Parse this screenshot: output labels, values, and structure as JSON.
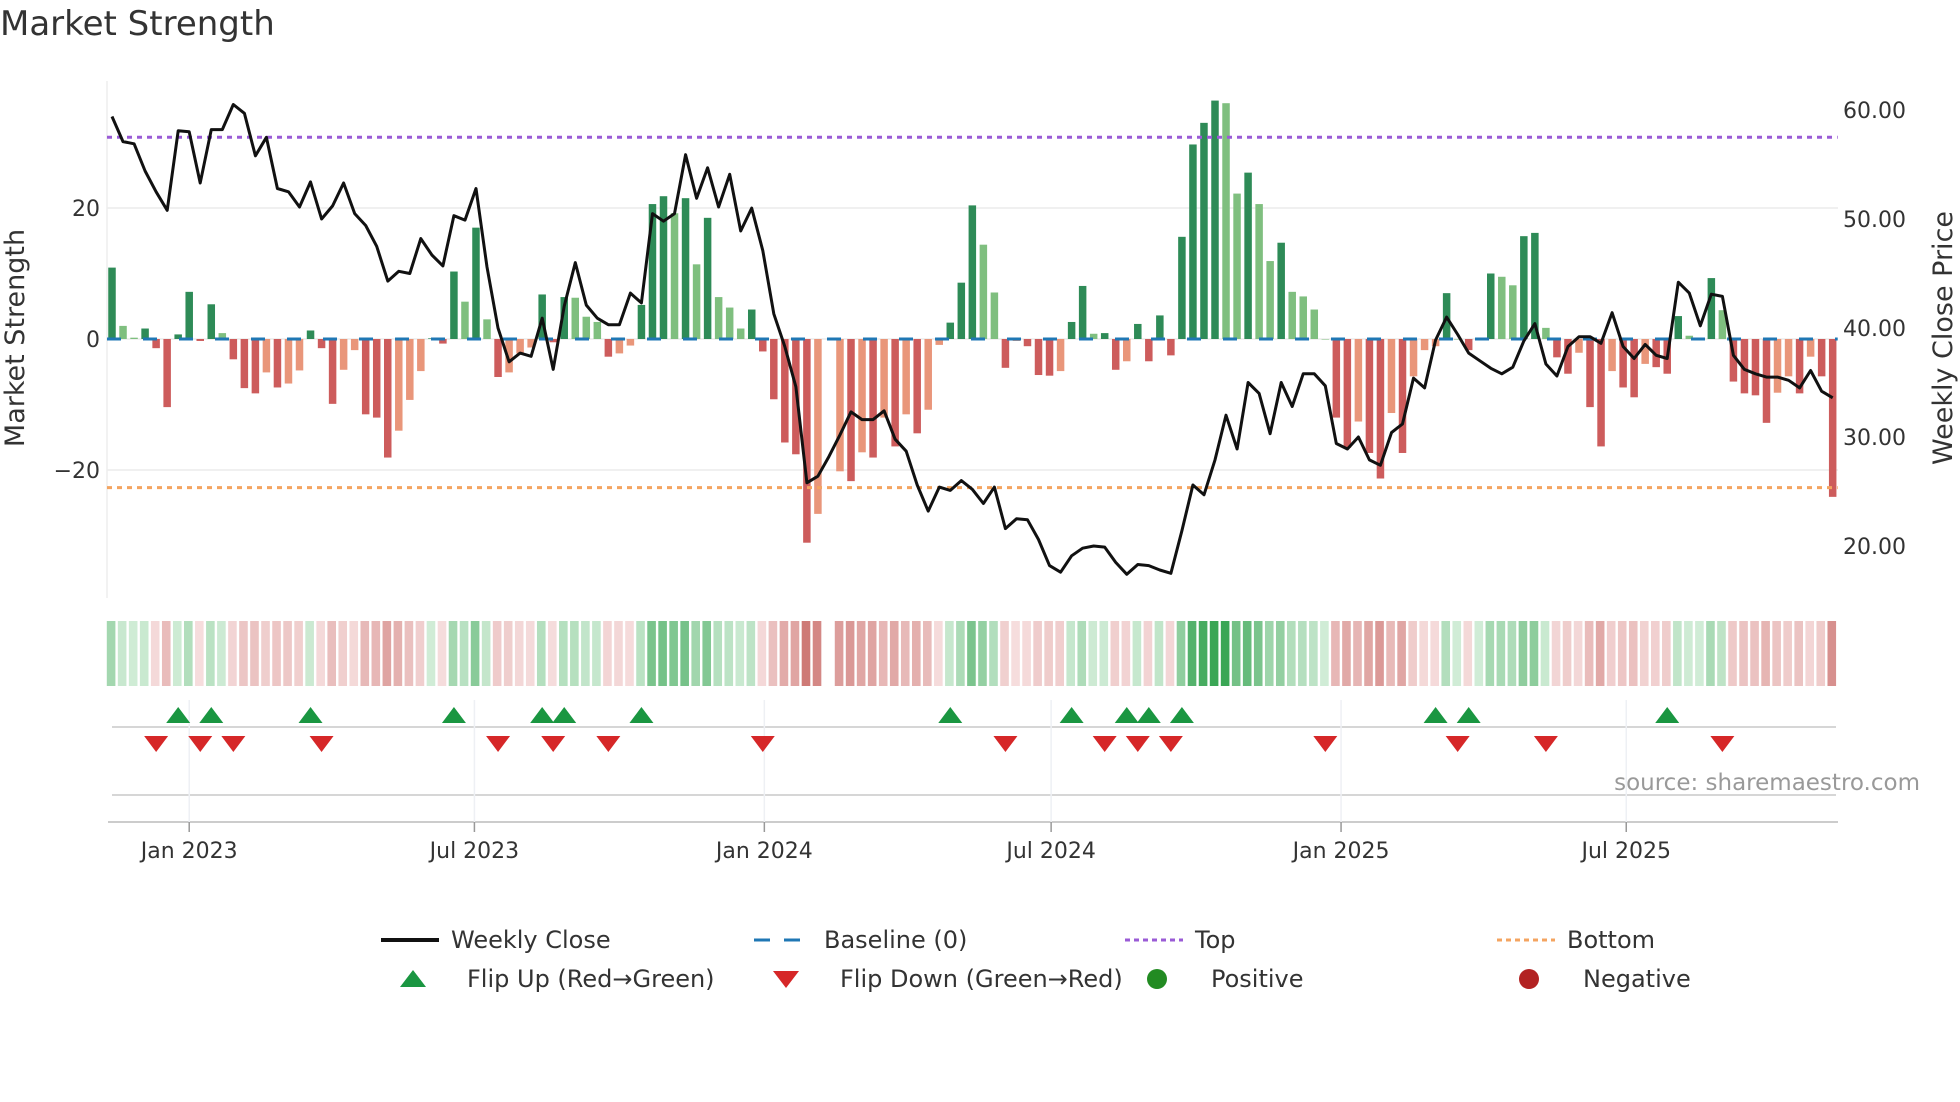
{
  "chart_data": {
    "type": "bar",
    "title": "Market Strength",
    "ylabel": "Market Strength",
    "y2label": "Weekly Close Price",
    "ylim": [
      -38,
      40
    ],
    "y2lim": [
      15.5,
      62
    ],
    "yticks": [
      -20,
      0,
      20
    ],
    "ytick_labels": [
      "−20",
      "0",
      "20"
    ],
    "y2ticks": [
      20,
      30,
      40,
      50,
      60
    ],
    "y2tick_labels": [
      "20.00",
      "30.00",
      "40.00",
      "50.00",
      "60.00"
    ],
    "first_week": "2022-11-13",
    "xtick_dates": [
      "2023-01-01",
      "2023-07-01",
      "2024-01-01",
      "2024-07-01",
      "2025-01-01",
      "2025-07-01"
    ],
    "xtick_labels": [
      "Jan 2023",
      "Jul 2023",
      "Jan 2024",
      "Jul 2024",
      "Jan 2025",
      "Jul 2025"
    ],
    "top_level": 30.8,
    "bottom_level": -22.7,
    "baseline": 0,
    "strength": [
      10.9,
      2,
      0.2,
      1.6,
      -1.4,
      -10.4,
      0.7,
      7.2,
      -0.3,
      5.3,
      0.9,
      -3.1,
      -7.5,
      -8.3,
      -5.1,
      -7.4,
      -6.8,
      -4.8,
      1.3,
      -1.4,
      -9.9,
      -4.7,
      -1.7,
      -11.5,
      -12,
      -18.1,
      -14,
      -9.3,
      -4.9,
      0.1,
      -0.7,
      10.3,
      5.7,
      17,
      3,
      -5.8,
      -5.1,
      -2.2,
      -1.3,
      6.8,
      -0.5,
      6.4,
      6.3,
      3.4,
      2.6,
      -2.7,
      -2.2,
      -1,
      5.2,
      20.6,
      21.8,
      19.2,
      21.5,
      11.4,
      18.5,
      6.4,
      4.8,
      1.6,
      4.5,
      -1.9,
      -9.2,
      -15.8,
      -17.6,
      -31.1,
      -26.7,
      null,
      -20.2,
      -21.7,
      -17.3,
      -18.1,
      -12,
      -16.4,
      -11.5,
      -14.4,
      -10.8,
      -0.9,
      2.5,
      8.6,
      20.4,
      14.4,
      7.1,
      -4.4,
      -0.3,
      -1.1,
      -5.5,
      -5.6,
      -4.9,
      2.6,
      8.1,
      0.8,
      0.9,
      -4.7,
      -3.4,
      2.3,
      -3.4,
      3.6,
      -2.5,
      15.6,
      29.7,
      33,
      36.4,
      36,
      22.2,
      25.4,
      20.6,
      11.9,
      14.7,
      7.2,
      6.5,
      4.5,
      0,
      -12,
      -16.6,
      -12.6,
      -17.4,
      -21.3,
      -11.3,
      -17.4,
      -5.7,
      -1.7,
      -1.1,
      7,
      0,
      -1.7,
      0,
      10,
      9.5,
      8.2,
      15.7,
      16.2,
      1.7,
      -2.8,
      -5.3,
      -2.1,
      -10.4,
      -16.4,
      -4.9,
      -7.4,
      -8.9,
      -3.8,
      -4.3,
      -5.3,
      3.5,
      0.5,
      0,
      9.3,
      4.4,
      -6.5,
      -8.3,
      -8.6,
      -12.8,
      -8.2,
      -5.7,
      -8.3,
      -2.7,
      -5.7,
      -24.1
    ],
    "weekly_close": [
      59.4,
      57.1,
      56.9,
      54.4,
      52.5,
      50.8,
      58.1,
      58,
      53.3,
      58.2,
      58.2,
      60.5,
      59.7,
      55.8,
      57.5,
      52.8,
      52.5,
      51.1,
      53.4,
      50,
      51.2,
      53.3,
      50.5,
      49.4,
      47.5,
      44.3,
      45.2,
      45,
      48.2,
      46.7,
      45.7,
      50.3,
      49.9,
      52.8,
      45.6,
      40,
      36.9,
      37.7,
      37.4,
      40.9,
      36.2,
      42,
      46,
      42.1,
      40.9,
      40.3,
      40.3,
      43.2,
      42.3,
      50.5,
      49.8,
      50.5,
      55.9,
      51.9,
      54.7,
      51.1,
      54.1,
      48.9,
      51,
      47.1,
      41.3,
      38.3,
      34.6,
      25.8,
      26.4,
      28.2,
      30.2,
      32.3,
      31.6,
      31.6,
      32.4,
      29.8,
      28.7,
      25.6,
      23.2,
      25.4,
      25.1,
      26,
      25.2,
      23.9,
      25.4,
      21.6,
      22.5,
      22.4,
      20.6,
      18.2,
      17.6,
      19.1,
      19.8,
      20,
      19.9,
      18.5,
      17.4,
      18.3,
      18.2,
      17.8,
      17.5,
      21.4,
      25.6,
      24.7,
      27.9,
      32,
      28.9,
      35,
      34,
      30.3,
      35,
      32.8,
      35.8,
      35.8,
      34.7,
      29.4,
      28.9,
      30,
      27.9,
      27.4,
      30.4,
      31.2,
      35.4,
      34.5,
      38.9,
      41,
      39.4,
      37.7,
      37,
      36.3,
      35.8,
      36.4,
      38.8,
      40.4,
      36.7,
      35.6,
      38.3,
      39.2,
      39.2,
      38.6,
      41.4,
      38.3,
      37.2,
      38.5,
      37.5,
      37.2,
      44.2,
      43.2,
      40.2,
      43.1,
      42.9,
      37.5,
      36.2,
      35.8,
      35.5,
      35.5,
      35.2,
      34.5,
      36.1,
      34.2,
      33.6
    ],
    "flip_up_weeks": [
      6,
      9,
      18,
      31,
      39,
      41,
      48,
      76,
      87,
      92,
      94,
      97,
      120,
      123,
      141
    ],
    "flip_down_weeks": [
      4,
      8,
      11,
      19,
      35,
      40,
      45,
      59,
      81,
      90,
      93,
      96,
      110,
      122,
      130,
      146
    ],
    "legend": {
      "close": "Weekly Close",
      "baseline": "Baseline (0)",
      "top": "Top",
      "bottom": "Bottom",
      "flip_up": "Flip Up (Red→Green)",
      "flip_down": "Flip Down (Green→Red)",
      "positive": "Positive",
      "negative": "Negative"
    },
    "legend_placement": "bottom",
    "source": "source: sharemaestro.com",
    "colors": {
      "pos_strong": "#2e8b57",
      "pos_weak": "#7fbf7f",
      "neg_strong": "#cd5c5c",
      "neg_weak": "#e9967a",
      "close": "#111111",
      "baseline": "#1f77b4",
      "top": "#9a5bd6",
      "bottom": "#f4a460",
      "flip_up": "#1a9641",
      "flip_down": "#d62728",
      "positive": "#228b22",
      "negative": "#b22222"
    }
  }
}
